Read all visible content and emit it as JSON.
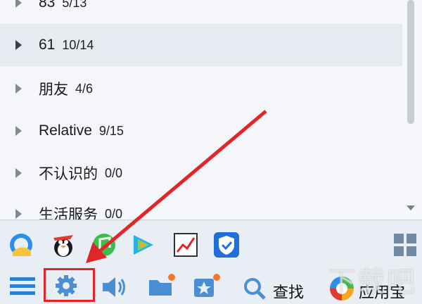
{
  "groups": [
    {
      "name": "83",
      "count": "5/13"
    },
    {
      "name": "61",
      "count": "10/14"
    },
    {
      "name": "朋友",
      "count": "4/6"
    },
    {
      "name": "Relative",
      "count": "9/15"
    },
    {
      "name": "不认识的",
      "count": "0/0"
    },
    {
      "name": "生活服务",
      "count": "0/0"
    }
  ],
  "app_icons": [
    "qzone-icon",
    "penguin-game-icon",
    "music-icon",
    "video-icon",
    "stock-icon",
    "security-shield-icon",
    "app-grid-icon"
  ],
  "bottom_bar": {
    "find_label": "查找",
    "app_store_label": "应用宝"
  },
  "watermark": "下载吧",
  "colors": {
    "highlight": "#e0262b",
    "accent_blue": "#1e6fd9"
  }
}
